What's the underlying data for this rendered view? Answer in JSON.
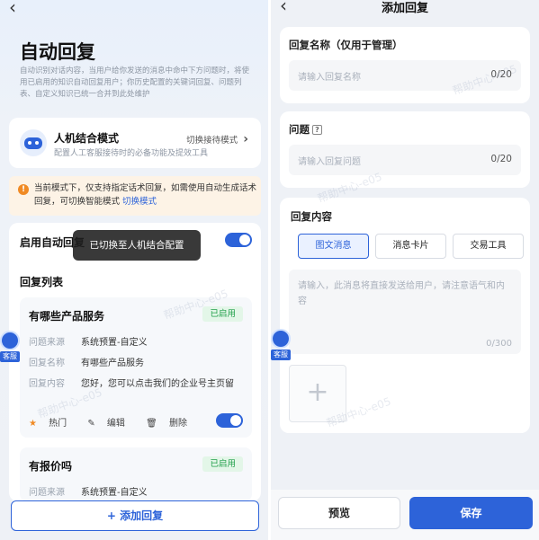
{
  "left": {
    "back_glyph": "‹",
    "title": "自动回复",
    "description": "自动识别对话内容，当用户给你发送的消息中命中下方问题时，将使用已启用的知识自动回复用户；你历史配置的关键词回复、问题列表、自定义知识已统一合并到此处维护",
    "mode": {
      "title": "人机结合模式",
      "subtitle": "配置人工客服接待时的必备功能及提效工具",
      "switch_label": "切换接待模式",
      "chevron": "›"
    },
    "notice": {
      "icon": "!",
      "text": "当前模式下，仅支持指定话术回复，如需使用自动生成话术回复，可切换智能模式",
      "link": "切换模式"
    },
    "enable_label": "启用自动回复",
    "toast": "已切换至人机结合配置",
    "list_title": "回复列表",
    "items": [
      {
        "title": "有哪些产品服务",
        "status": "已启用",
        "rows": [
          {
            "k": "问题来源",
            "v": "系统预置-自定义"
          },
          {
            "k": "回复名称",
            "v": "有哪些产品服务"
          },
          {
            "k": "回复内容",
            "v": "您好，您可以点击我们的企业号主页留"
          }
        ],
        "actions": {
          "hot": "热门",
          "edit": "编辑",
          "delete": "删除"
        }
      },
      {
        "title": "有报价吗",
        "status": "已启用",
        "rows": [
          {
            "k": "问题来源",
            "v": "系统预置-自定义"
          }
        ]
      }
    ],
    "add_button": "+ 添加回复",
    "kefu_label": "客服",
    "watermark": "帮助中心-e05"
  },
  "right": {
    "back_glyph": "‹",
    "title": "添加回复",
    "name_field": {
      "label": "回复名称（仅用于管理）",
      "placeholder": "请输入回复名称",
      "counter": "0/20"
    },
    "question_field": {
      "label": "问题",
      "help_icon": "?",
      "placeholder": "请输入回复问题",
      "counter": "0/20"
    },
    "content_field": {
      "label": "回复内容",
      "tabs": [
        "图文消息",
        "消息卡片",
        "交易工具"
      ],
      "active_tab": 0,
      "placeholder": "请输入，此消息将直接发送给用户，请注意语气和内容",
      "counter": "0/300",
      "add_glyph": "+"
    },
    "preview_button": "预览",
    "save_button": "保存",
    "kefu_label": "客服",
    "watermark": "帮助中心-e05"
  },
  "colors": {
    "accent": "#2d63d9",
    "success": "#21a04a",
    "warning": "#f08a24"
  }
}
